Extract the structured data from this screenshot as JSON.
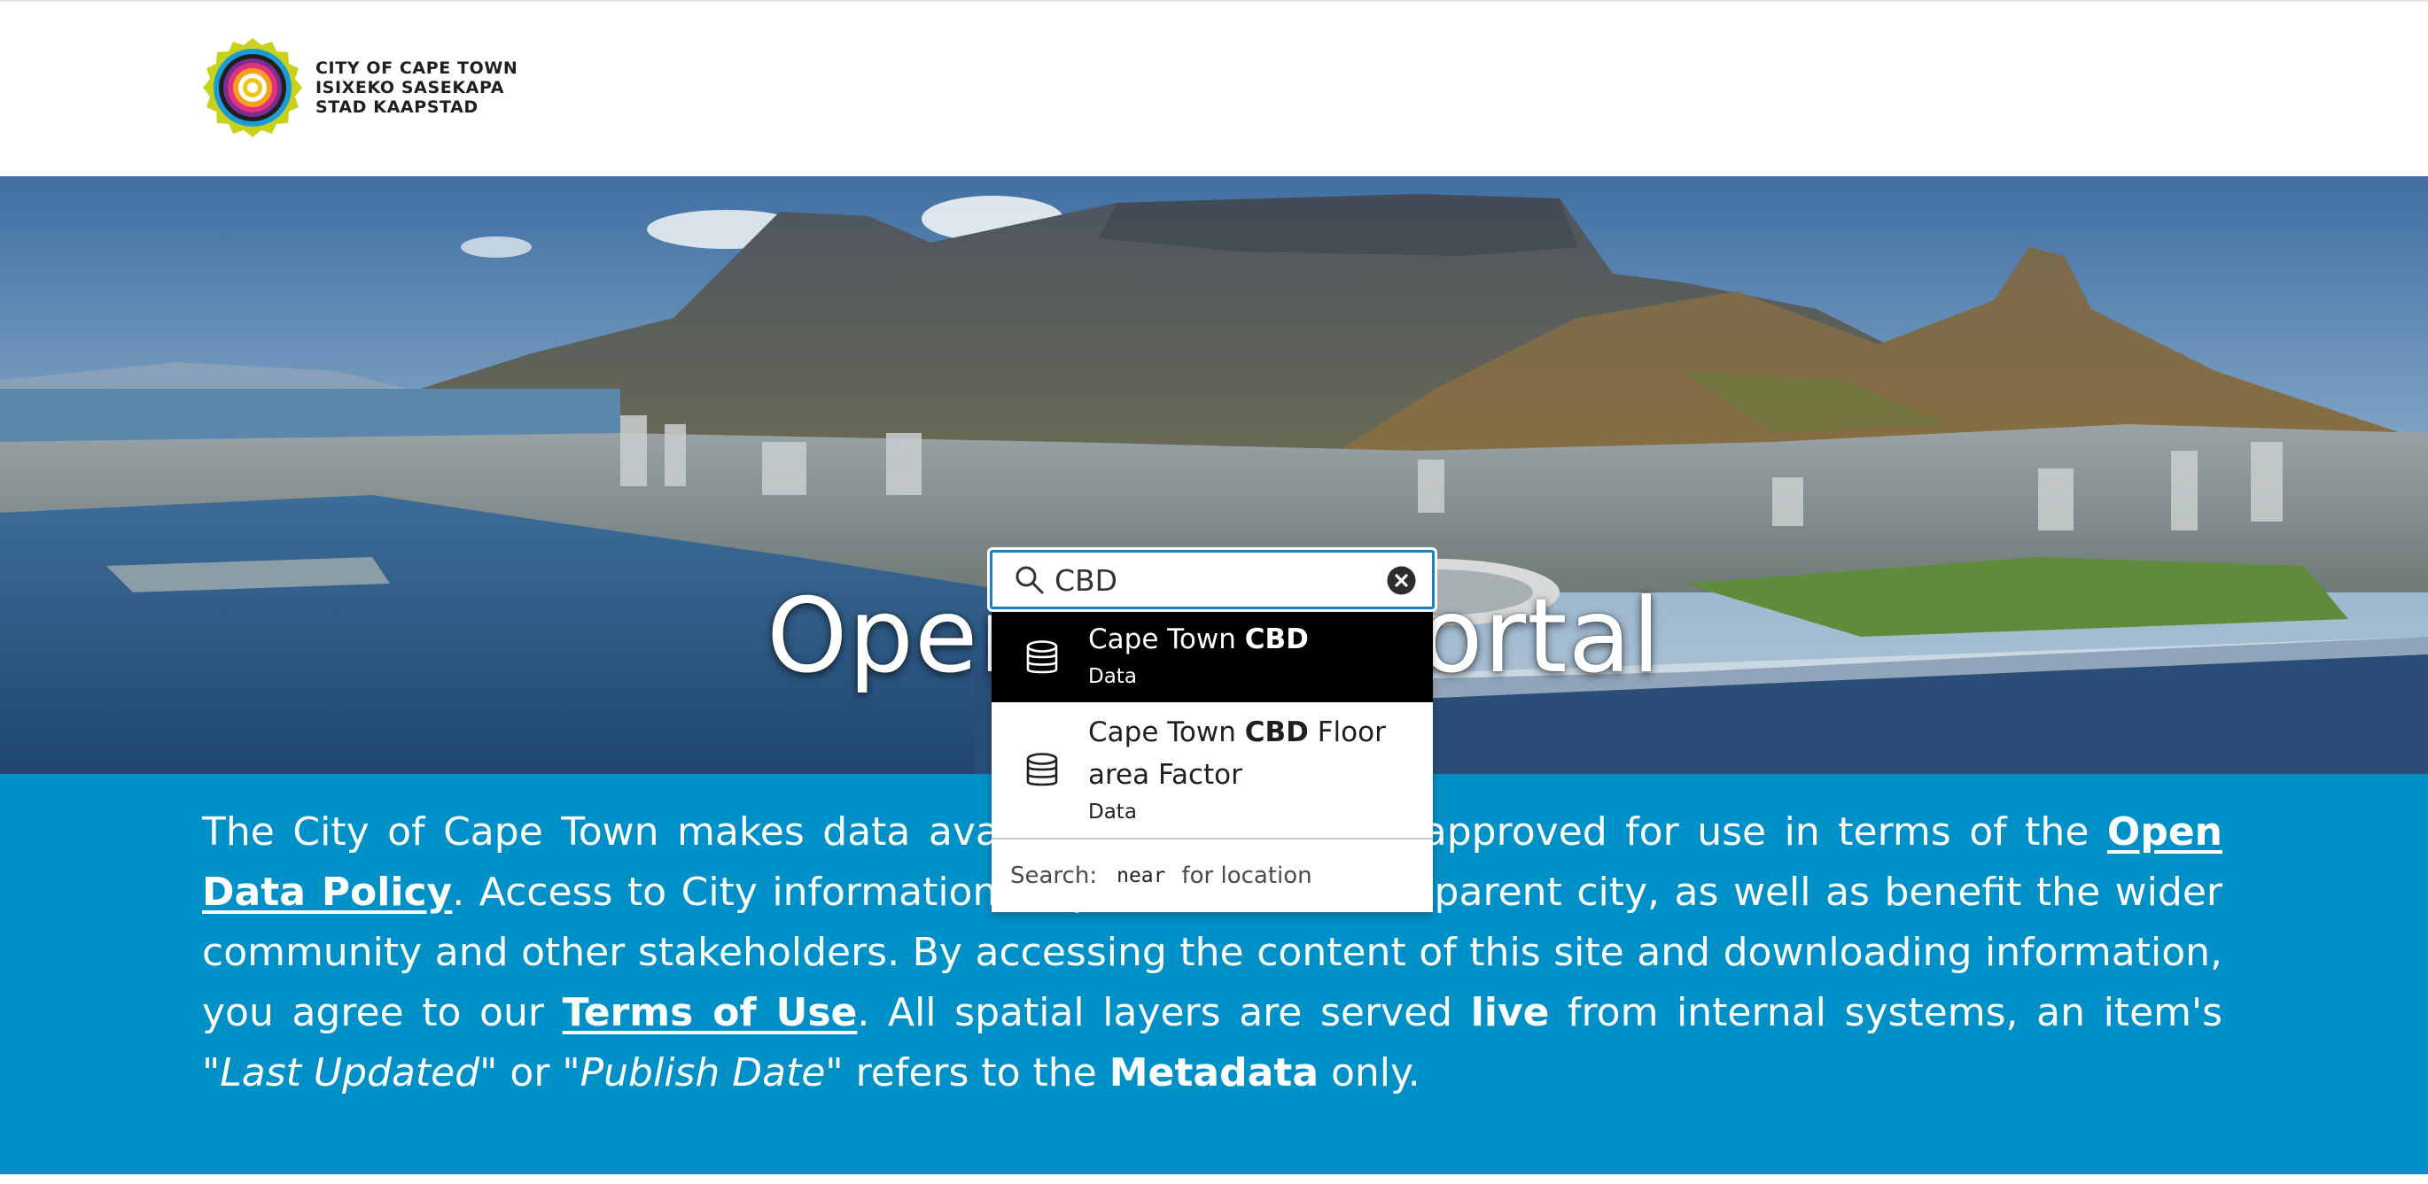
{
  "header": {
    "logo_lines": [
      "CITY OF CAPE TOWN",
      "ISIXEKO SASEKAPA",
      "STAD KAAPSTAD"
    ]
  },
  "hero": {
    "title": "Open Data Portal"
  },
  "search": {
    "value": "CBD",
    "placeholder": "",
    "suggestions": [
      {
        "title_prefix": "Cape Town ",
        "title_match": "CBD",
        "title_suffix": "",
        "type": "Data",
        "active": true
      },
      {
        "title_prefix": "Cape Town ",
        "title_match": "CBD",
        "title_suffix": " Floor area Factor",
        "type": "Data",
        "active": false
      }
    ],
    "hint_prefix": "Search:",
    "hint_code": "near",
    "hint_suffix": "for location"
  },
  "intro": {
    "text_1": "The City of Cape Town makes data available that has been approved for use in terms of the ",
    "open_data_policy_link": "Open Data Policy",
    "text_2": ". Access to City information helps to build a transparent city, as well as benefit the wider community and other stakeholders. By accessing the content of this site and downloading information, you agree to our ",
    "terms_link": "Terms of Use",
    "text_3": ". All spatial layers are served ",
    "live_word": "live",
    "text_4": " from internal systems, an item's \"",
    "last_updated": "Last Updated",
    "text_5": "\" or \"",
    "publish_date": "Publish Date",
    "text_6": "\" refers to the ",
    "metadata_word": "Metadata",
    "text_7": " only."
  },
  "colors": {
    "brand_blue": "#0090c8",
    "focus_blue": "#1f7fc4",
    "active_item": "#000000",
    "logo_yellow": "#c9d21a"
  },
  "icons": {
    "search": "search-icon",
    "clear": "clear-circle-icon",
    "dataset": "database-icon"
  }
}
